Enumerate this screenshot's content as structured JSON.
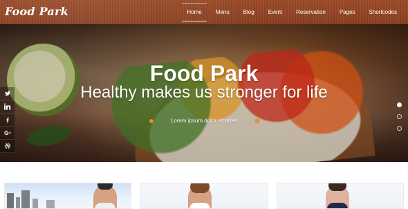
{
  "header": {
    "logo_text": "Food Park",
    "nav": [
      {
        "label": "Home",
        "active": true
      },
      {
        "label": "Menu",
        "active": false
      },
      {
        "label": "Blog",
        "active": false
      },
      {
        "label": "Event",
        "active": false
      },
      {
        "label": "Reservation",
        "active": false
      },
      {
        "label": "Pages",
        "active": false
      },
      {
        "label": "Shortcodes",
        "active": false
      }
    ]
  },
  "hero": {
    "title": "Food Park",
    "subtitle": "Healthy makes us stronger for life",
    "lorem": "Lorem ipsum dolor sit amet",
    "accent_color": "#f08a2a",
    "slider": {
      "dots": 3,
      "active_index": 0
    }
  },
  "social": {
    "icons": [
      "twitter-icon",
      "linkedin-icon",
      "facebook-icon",
      "google-plus-icon",
      "dribbble-icon"
    ]
  },
  "cards": {
    "items": [
      {
        "type": "city-person"
      },
      {
        "type": "person"
      },
      {
        "type": "person"
      }
    ]
  }
}
